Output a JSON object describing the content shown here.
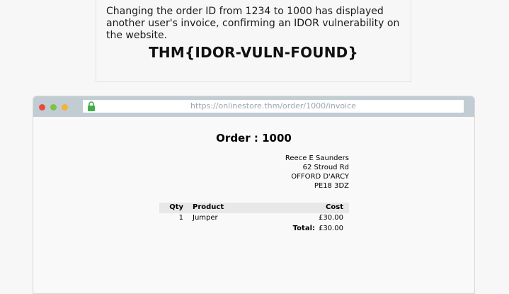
{
  "note": {
    "text": "Changing the order ID from 1234 to 1000 has displayed another user's invoice, confirming an IDOR vulnerability on the website.",
    "flag": "THM{IDOR-VULN-FOUND}"
  },
  "browser": {
    "url": "https://onlinestore.thm/order/1000/invoice",
    "lock_icon": "lock-icon",
    "window_controls": [
      "close",
      "minimize",
      "maximize"
    ]
  },
  "invoice": {
    "heading": "Order : 1000",
    "address": [
      "Reece E Saunders",
      "62 Stroud Rd",
      "OFFORD D'ARCY",
      "PE18 3DZ"
    ],
    "columns": {
      "qty": "Qty",
      "product": "Product",
      "cost": "Cost"
    },
    "items": [
      {
        "qty": "1",
        "product": "Jumper",
        "cost": "£30.00"
      }
    ],
    "total_label": "Total:",
    "total_value": "£30.00"
  }
}
